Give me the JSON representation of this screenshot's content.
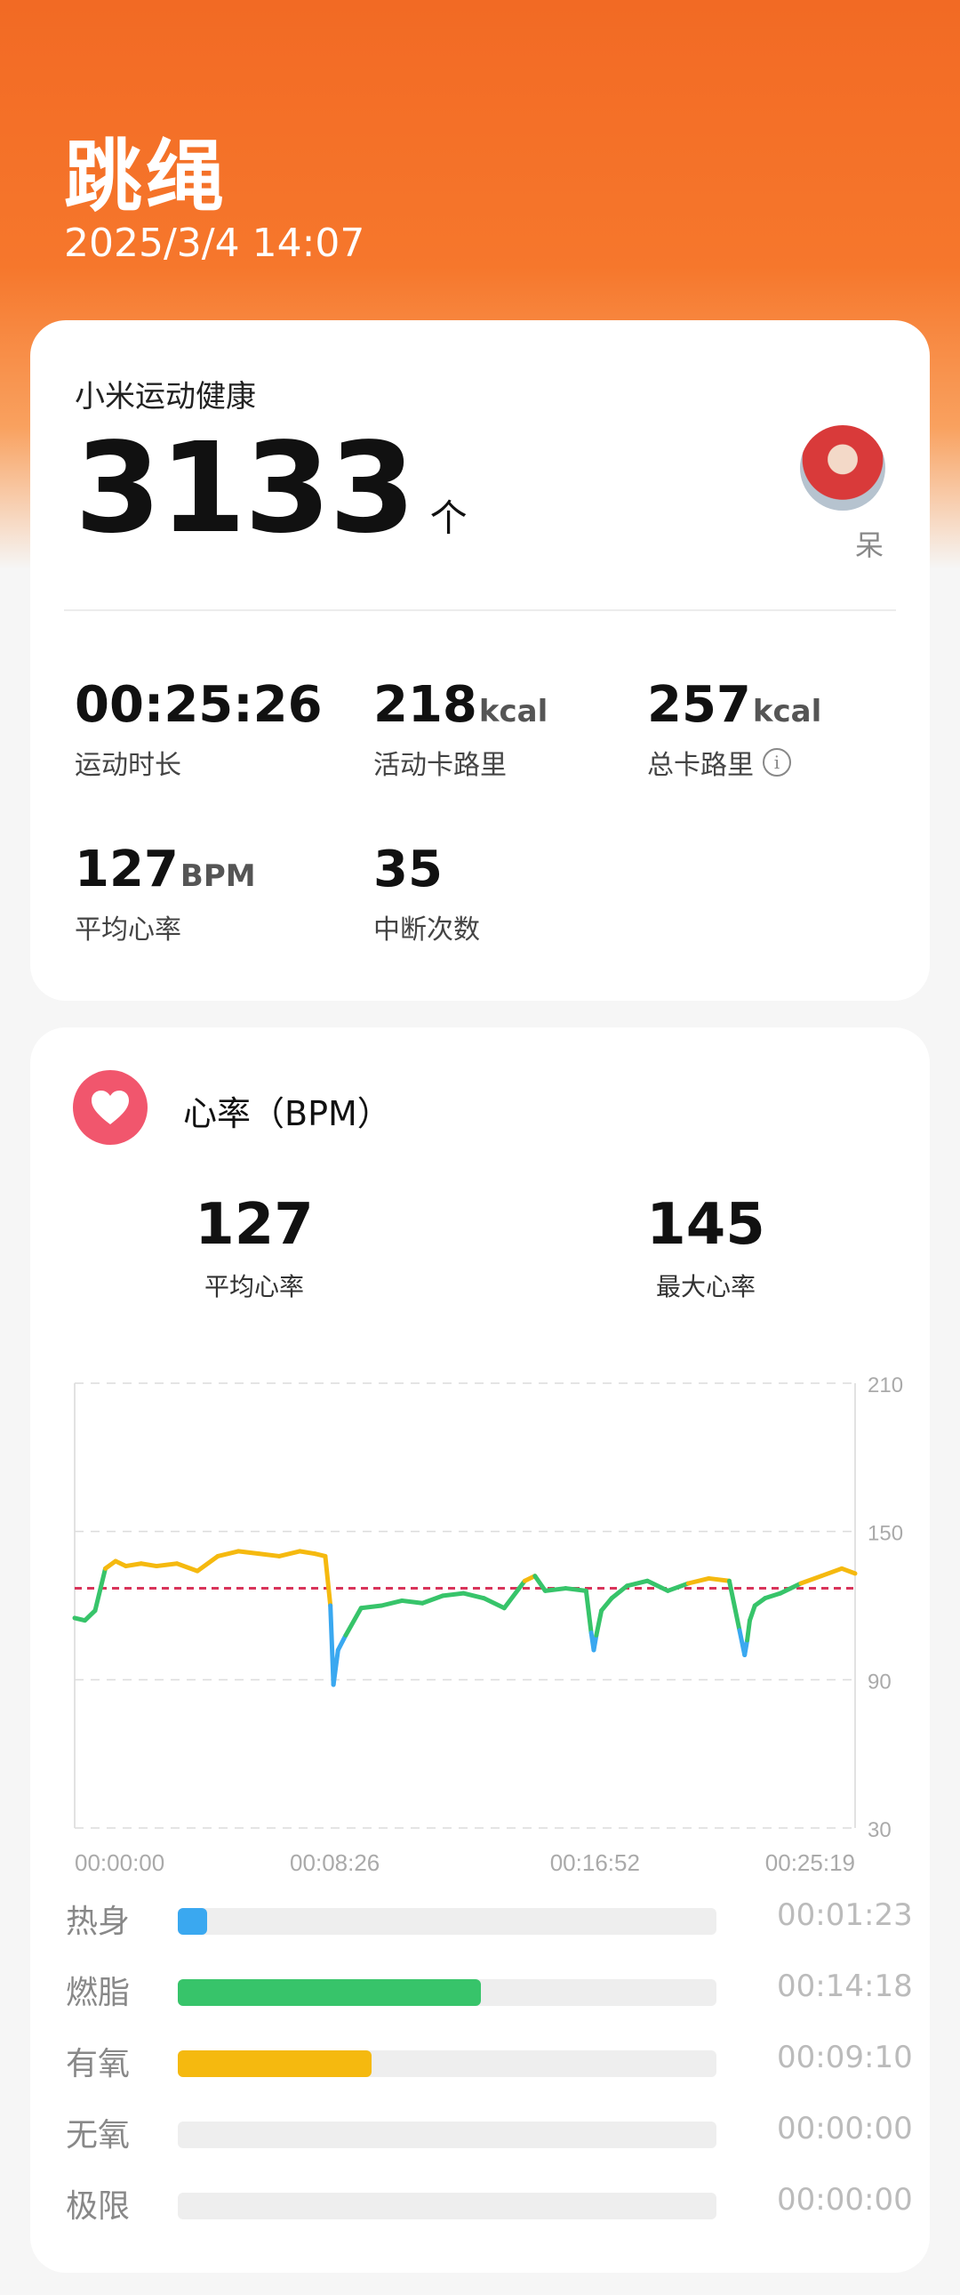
{
  "header": {
    "title": "跳绳",
    "datetime": "2025/3/4 14:07"
  },
  "summary": {
    "source_app": "小米运动健康",
    "count": "3133",
    "count_unit": "个",
    "user_name": "呆",
    "stats": [
      {
        "value": "00:25:26",
        "unit": "",
        "label": "运动时长",
        "info": false
      },
      {
        "value": "218",
        "unit": "kcal",
        "label": "活动卡路里",
        "info": false
      },
      {
        "value": "257",
        "unit": "kcal",
        "label": "总卡路里",
        "info": true
      },
      {
        "value": "127",
        "unit": "BPM",
        "label": "平均心率",
        "info": false
      },
      {
        "value": "35",
        "unit": "",
        "label": "中断次数",
        "info": false
      }
    ]
  },
  "heart_rate": {
    "title": "心率（BPM）",
    "avg_value": "127",
    "avg_label": "平均心率",
    "max_value": "145",
    "max_label": "最大心率"
  },
  "chart_data": {
    "type": "line",
    "x_tick_labels": [
      "00:00:00",
      "00:08:26",
      "00:16:52",
      "00:25:19"
    ],
    "y_tick_labels": [
      "210",
      "150",
      "90",
      "30"
    ],
    "ylim": [
      30,
      210
    ],
    "xlim_seconds": [
      0,
      1526
    ],
    "reference_line_bpm": 127,
    "zone_colors": {
      "warmup": "#3aa8f0",
      "fatburn": "#37c46a",
      "aerobic": "#f5b90f"
    },
    "series": [
      {
        "values_time_s": [
          0,
          20,
          40,
          60,
          80,
          100,
          130,
          160,
          200,
          240,
          280,
          320,
          360,
          400,
          440,
          470,
          490,
          500,
          506,
          515,
          530,
          560,
          600,
          640,
          680,
          720,
          760,
          800,
          840,
          880,
          900,
          920,
          960,
          1000,
          1010,
          1015,
          1020,
          1030,
          1050,
          1080,
          1120,
          1160,
          1200,
          1240,
          1280,
          1300,
          1310,
          1315,
          1320,
          1330,
          1350,
          1380,
          1420,
          1460,
          1500,
          1526
        ],
        "values_bpm": [
          115,
          114,
          118,
          135,
          138,
          136,
          137,
          136,
          137,
          134,
          140,
          142,
          141,
          140,
          142,
          141,
          140,
          120,
          88,
          102,
          108,
          119,
          120,
          122,
          121,
          124,
          125,
          123,
          119,
          130,
          132,
          126,
          127,
          126,
          109,
          102,
          108,
          118,
          123,
          128,
          130,
          126,
          129,
          131,
          130,
          110,
          100,
          106,
          114,
          120,
          123,
          125,
          129,
          132,
          135,
          133
        ]
      }
    ]
  },
  "zones": [
    {
      "name": "热身",
      "duration": "00:01:23",
      "fraction": 0.054,
      "color": "#3aa8f0"
    },
    {
      "name": "燃脂",
      "duration": "00:14:18",
      "fraction": 0.562,
      "color": "#37c46a"
    },
    {
      "name": "有氧",
      "duration": "00:09:10",
      "fraction": 0.36,
      "color": "#f5b90f"
    },
    {
      "name": "无氧",
      "duration": "00:00:00",
      "fraction": 0,
      "color": "#f08a3a"
    },
    {
      "name": "极限",
      "duration": "00:00:00",
      "fraction": 0,
      "color": "#e8494a"
    }
  ]
}
